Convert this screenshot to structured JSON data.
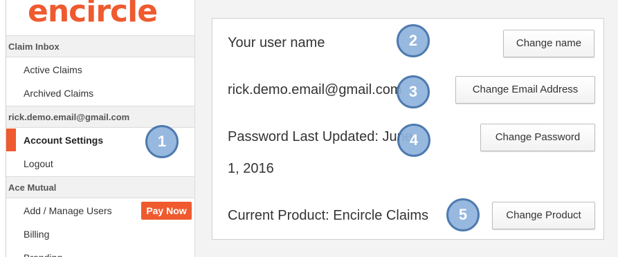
{
  "brand": {
    "logo_text": "encircle",
    "color": "#ef5a2f"
  },
  "sidebar": {
    "sections": [
      {
        "label": "Claim Inbox",
        "items": [
          {
            "label": "Active Claims"
          },
          {
            "label": "Archived Claims"
          }
        ]
      },
      {
        "label": "rick.demo.email@gmail.com",
        "items": [
          {
            "label": "Account Settings",
            "active": true
          },
          {
            "label": "Logout"
          }
        ]
      },
      {
        "label": "Ace Mutual",
        "items": [
          {
            "label": "Add / Manage Users",
            "badge": "Pay Now"
          },
          {
            "label": "Billing"
          },
          {
            "label": "Branding"
          }
        ]
      }
    ]
  },
  "settings": {
    "name": {
      "text": "Your user name",
      "button": "Change name"
    },
    "email": {
      "text": "rick.demo.email@gmail.com",
      "button": "Change Email Address"
    },
    "password": {
      "text_line1": "Password Last Updated: June",
      "text_line2": "1, 2016",
      "button": "Change Password"
    },
    "product": {
      "text": "Current Product: Encircle Claims",
      "button": "Change Product"
    }
  },
  "callouts": [
    "1",
    "2",
    "3",
    "4",
    "5"
  ]
}
